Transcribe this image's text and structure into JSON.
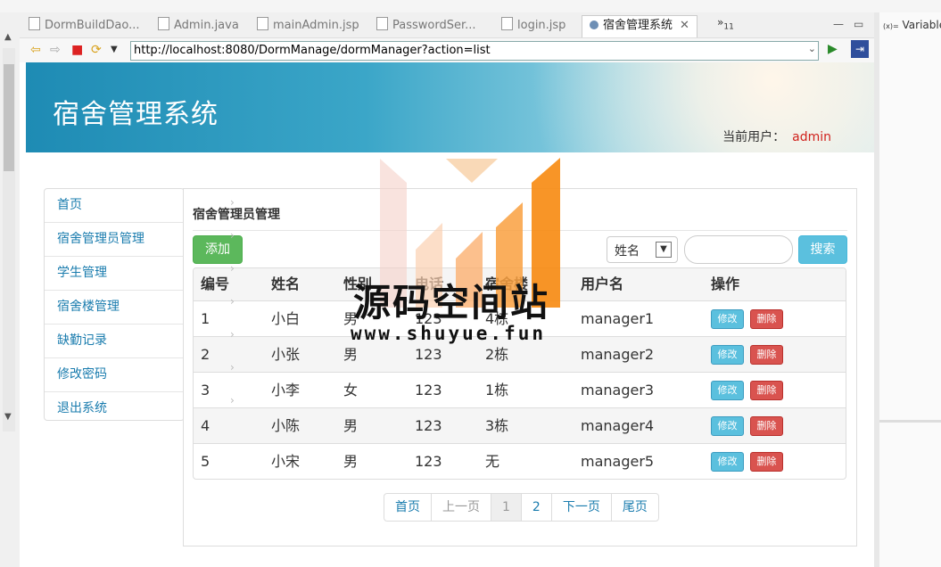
{
  "ide": {
    "tabs": [
      {
        "label": "DormBuildDao..."
      },
      {
        "label": "Admin.java"
      },
      {
        "label": "mainAdmin.jsp"
      },
      {
        "label": "PasswordSer..."
      },
      {
        "label": "login.jsp"
      },
      {
        "label": "宿舍管理系统"
      }
    ],
    "tab_overflow": "»",
    "tab_overflow_count": "11",
    "url": "http://localhost:8080/DormManage/dormManager?action=list",
    "right_panel_label": "Variable",
    "right_panel_prefix": "(x)="
  },
  "header": {
    "title": "宿舍管理系统",
    "current_user_label": "当前用户：",
    "current_user": "admin"
  },
  "sidebar": {
    "items": [
      {
        "label": "首页"
      },
      {
        "label": "宿舍管理员管理"
      },
      {
        "label": "学生管理"
      },
      {
        "label": "宿舍楼管理"
      },
      {
        "label": "缺勤记录"
      },
      {
        "label": "修改密码"
      },
      {
        "label": "退出系统"
      }
    ]
  },
  "main": {
    "title": "宿舍管理员管理",
    "add_label": "添加",
    "search_select_value": "姓名",
    "search_placeholder": "",
    "search_label": "搜索",
    "columns": [
      "编号",
      "姓名",
      "性别",
      "电话",
      "宿舍楼",
      "用户名",
      "操作"
    ],
    "rows": [
      {
        "id": "1",
        "name": "小白",
        "sex": "男",
        "tel": "123",
        "building": "4栋",
        "username": "manager1"
      },
      {
        "id": "2",
        "name": "小张",
        "sex": "男",
        "tel": "123",
        "building": "2栋",
        "username": "manager2"
      },
      {
        "id": "3",
        "name": "小李",
        "sex": "女",
        "tel": "123",
        "building": "1栋",
        "username": "manager3"
      },
      {
        "id": "4",
        "name": "小陈",
        "sex": "男",
        "tel": "123",
        "building": "3栋",
        "username": "manager4"
      },
      {
        "id": "5",
        "name": "小宋",
        "sex": "男",
        "tel": "123",
        "building": "无",
        "username": "manager5"
      }
    ],
    "edit_label": "修改",
    "delete_label": "删除",
    "pagination": [
      "首页",
      "上一页",
      "1",
      "2",
      "下一页",
      "尾页"
    ]
  },
  "watermark": {
    "text": "源码空间站",
    "url": "www.shuyue.fun"
  },
  "colors": {
    "primary_link": "#1a7cae",
    "success": "#5cb85c",
    "info": "#5bc0de",
    "danger": "#d9534f",
    "user_name": "#d0211c"
  }
}
